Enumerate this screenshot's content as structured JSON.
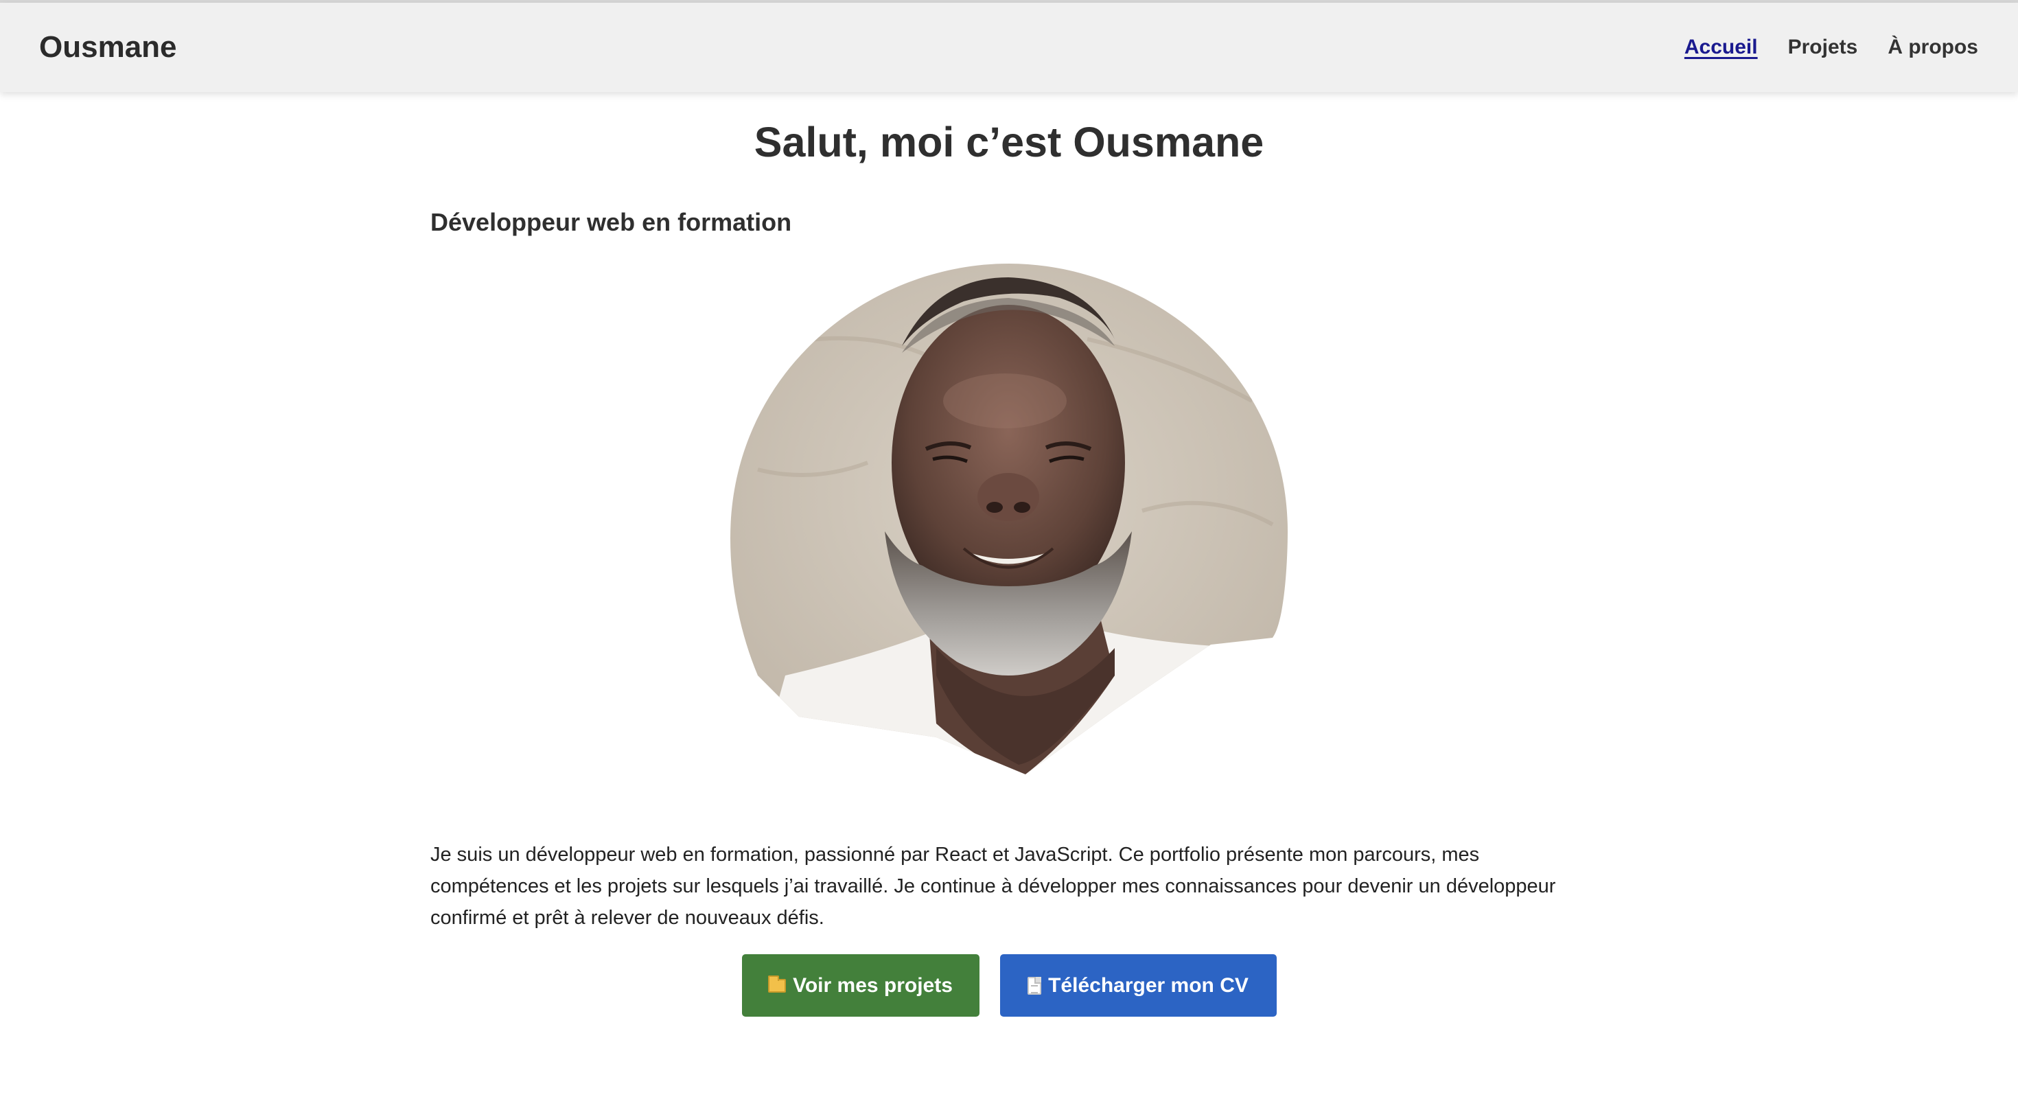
{
  "navbar": {
    "brand": "Ousmane",
    "links": [
      {
        "label": "Accueil",
        "active": true
      },
      {
        "label": "Projets",
        "active": false
      },
      {
        "label": "À propos",
        "active": false
      }
    ]
  },
  "hero": {
    "title": "Salut, moi c’est Ousmane",
    "subtitle": "Développeur web en formation",
    "bio": "Je suis un développeur web en formation, passionné par React et JavaScript. Ce portfolio présente mon parcours, mes compétences et les projets sur lesquels j’ai travaillé. Je continue à développer mes connaissances pour devenir un développeur confirmé et prêt à relever de nouveaux défis."
  },
  "buttons": {
    "projects": {
      "label": "Voir mes projets",
      "icon": "folder-icon",
      "color": "#43803b"
    },
    "cv": {
      "label": "Télécharger mon CV",
      "icon": "document-icon",
      "color": "#2c64c4"
    }
  }
}
